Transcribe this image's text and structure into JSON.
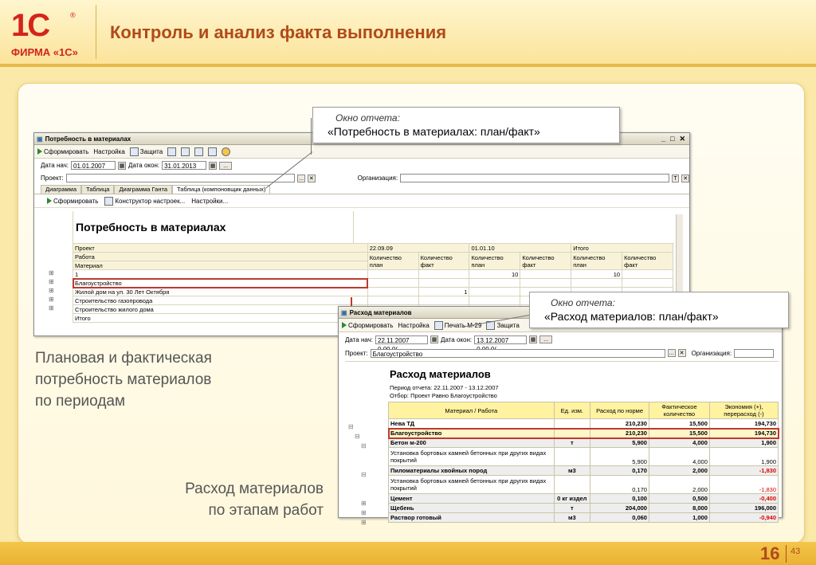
{
  "header": {
    "logo_text": "ФИРМА «1С»",
    "logo_mark": "1С",
    "logo_reg": "®",
    "title": "Контроль и анализ факта выполнения"
  },
  "footer": {
    "page": "16",
    "total": "43"
  },
  "callout1": {
    "line1": "Окно отчета:",
    "line2": "«Потребность в материалах: план/факт»"
  },
  "callout2": {
    "line1": "Окно отчета:",
    "line2": "«Расход материалов: план/факт»"
  },
  "text_left1": [
    "Плановая и фактическая",
    "потребность материалов",
    "по периодам"
  ],
  "text_left2": [
    "Расход материалов",
    "по этапам работ"
  ],
  "win1": {
    "title": "Потребность в материалах",
    "toolbar": [
      "Сформировать",
      "Настройка",
      "Защита"
    ],
    "date_start_label": "Дата нач:",
    "date_start": "01.01.2007",
    "date_end_label": "Дата окон:",
    "date_end": "31.01.2013",
    "project_label": "Проект:",
    "org_label": "Организация:",
    "tabs": [
      "Диаграмма",
      "Таблица",
      "Диаграмма Ганта",
      "Таблица (компоновщик данных)"
    ],
    "subtoolbar": [
      "Сформировать",
      "Конструктор настроек...",
      "Настройки..."
    ],
    "report_title": "Потребность в материалах",
    "col_groups": [
      "22.09.09",
      "01.01.10",
      "Итого"
    ],
    "row_heads": [
      "Проект",
      "Работа",
      "Материал"
    ],
    "qty_plan": "Количество план",
    "qty_fact": "Количество факт",
    "rows": [
      {
        "name": "1",
        "c3": "10",
        "c5": "10"
      },
      {
        "name": "Благоустройство"
      },
      {
        "name": "Жилой дом на ул. 30 Лет Октября",
        "c2": "1"
      },
      {
        "name": "Строительство газопровода"
      },
      {
        "name": "Строительство жилого дома"
      },
      {
        "name": "Итого"
      }
    ]
  },
  "win2": {
    "title": "Расход материалов",
    "toolbar": [
      "Сформировать",
      "Настройка",
      "Печать М-29",
      "Защита"
    ],
    "date_start_label": "Дата нач:",
    "date_start": "22.11.2007 0.00.0(",
    "date_end_label": "Дата окон:",
    "date_end": "13.12.2007 0.00.0(",
    "project_label": "Проект:",
    "project": "Благоустройство",
    "org_label": "Организация:",
    "report_title": "Расход материалов",
    "period": "Период отчета: 22.11.2007 - 13.12.2007",
    "filter": "Отбор: Проект Равно Благоустройство",
    "columns": [
      "Материал / Работа",
      "Ед. изм.",
      "Расход по норме",
      "Фактическое количество",
      "Экономия (+), перерасход (-)"
    ],
    "rows": [
      {
        "name": "Нева ТД",
        "unit": "",
        "norm": "210,230",
        "fact": "15,500",
        "diff": "194,730",
        "bold": true
      },
      {
        "name": "Благоустройство",
        "unit": "",
        "norm": "210,230",
        "fact": "15,500",
        "diff": "194,730",
        "bold": true,
        "hl": true
      },
      {
        "name": "Бетон м-200",
        "unit": "т",
        "norm": "5,900",
        "fact": "4,000",
        "diff": "1,900",
        "bold": true
      },
      {
        "name": "Установка бортовых камней бетонных при других видах покрытий",
        "unit": "",
        "norm": "5,900",
        "fact": "4,000",
        "diff": "1,900"
      },
      {
        "name": "Пиломатериалы хвойных пород",
        "unit": "м3",
        "norm": "0,170",
        "fact": "2,000",
        "diff": "-1,830",
        "bold": true,
        "red": true
      },
      {
        "name": "Установка бортовых камней бетонных при других видах покрытий",
        "unit": "",
        "norm": "0,170",
        "fact": "2,000",
        "diff": "-1,830",
        "red": true
      },
      {
        "name": "Цемент",
        "unit": "0 кг издел",
        "norm": "0,100",
        "fact": "0,500",
        "diff": "-0,400",
        "bold": true,
        "red": true
      },
      {
        "name": "Щебень",
        "unit": "т",
        "norm": "204,000",
        "fact": "8,000",
        "diff": "196,000",
        "bold": true
      },
      {
        "name": "Раствор готовый",
        "unit": "м3",
        "norm": "0,060",
        "fact": "1,000",
        "diff": "-0,940",
        "bold": true,
        "red": true
      }
    ]
  },
  "colors": {
    "accent": "#b04a1a",
    "highlight": "#c0392b",
    "header_bg": "#fff2a0"
  }
}
